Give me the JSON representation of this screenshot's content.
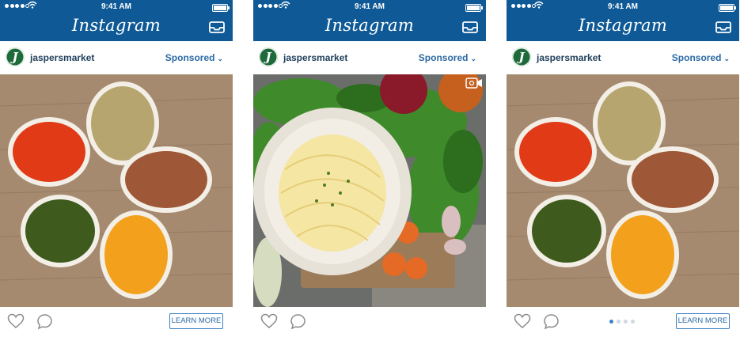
{
  "status": {
    "time": "9:41 AM"
  },
  "app": {
    "title": "Instagram"
  },
  "post": {
    "username": "jaspersmarket",
    "avatar_letter": "J",
    "sponsored_label": "Sponsored",
    "cta_label": "LEARN MORE"
  },
  "carousel": {
    "dots": 4,
    "active": 0
  },
  "icons": [
    "wifi-icon",
    "battery-icon",
    "inbox-icon",
    "chevron-down-icon",
    "heart-icon",
    "comment-icon",
    "video-icon"
  ],
  "colors": {
    "header": "#0f5a96",
    "link": "#2b6aa3"
  }
}
